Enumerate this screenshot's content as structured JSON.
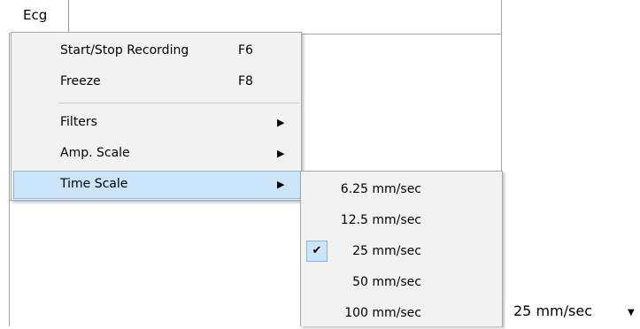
{
  "menubar": {
    "ecg_label": "Ecg"
  },
  "menu": {
    "items": [
      {
        "label": "Start/Stop Recording",
        "shortcut": "F6"
      },
      {
        "label": "Freeze",
        "shortcut": "F8"
      },
      {
        "label": "Filters",
        "submenu_arrow": "▶"
      },
      {
        "label": "Amp. Scale",
        "submenu_arrow": "▶"
      },
      {
        "label": "Time Scale",
        "submenu_arrow": "▶",
        "highlighted": true
      }
    ]
  },
  "submenu": {
    "checkmark": "✔",
    "items": [
      {
        "label": "6.25 mm/sec",
        "checked": false
      },
      {
        "label": "12.5 mm/sec",
        "checked": false
      },
      {
        "label": "25 mm/sec",
        "checked": true
      },
      {
        "label": "50 mm/sec",
        "checked": false
      },
      {
        "label": "100 mm/sec",
        "checked": false
      }
    ]
  },
  "time_combo": {
    "value": "25 mm/sec",
    "arrow": "▼"
  },
  "colors": {
    "highlight": "#cce4f7",
    "highlight_border": "#89b6e0",
    "menu_bg": "#f2f2f2"
  }
}
